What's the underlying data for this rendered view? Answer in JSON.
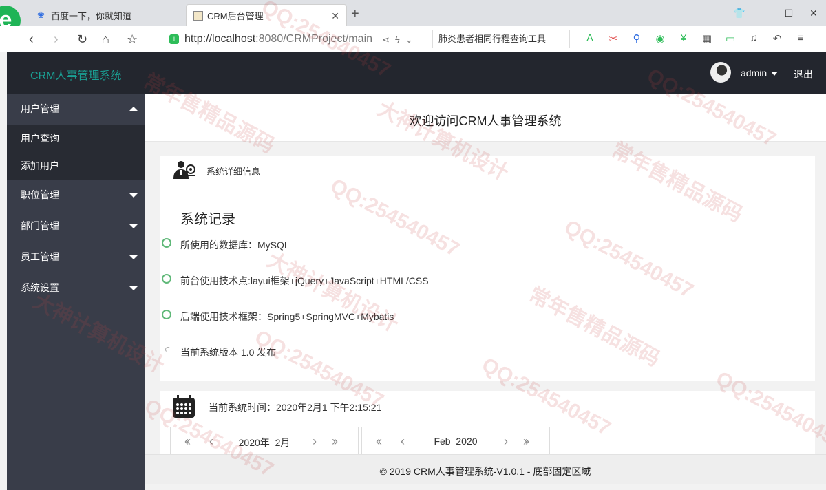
{
  "browser": {
    "tabs": [
      {
        "title": "百度一下，你就知道",
        "active": false
      },
      {
        "title": "CRM后台管理",
        "active": true
      }
    ],
    "url_host": "http://localhost",
    "url_rest": ":8080/CRMProject/main",
    "search_text": "肺炎患者相同行程查询工具"
  },
  "header": {
    "title": "CRM人事管理系统",
    "user": "admin",
    "logout": "退出"
  },
  "sidebar": {
    "items": [
      {
        "label": "用户管理",
        "expanded": true,
        "children": [
          {
            "label": "用户查询"
          },
          {
            "label": "添加用户"
          }
        ]
      },
      {
        "label": "职位管理",
        "expanded": false
      },
      {
        "label": "部门管理",
        "expanded": false
      },
      {
        "label": "员工管理",
        "expanded": false
      },
      {
        "label": "系统设置",
        "expanded": false
      }
    ]
  },
  "main": {
    "welcome": "欢迎访问CRM人事管理系统",
    "info_card": {
      "header": "系统详细信息",
      "records_title": "系统记录",
      "timeline": [
        {
          "text": "所使用的数据库：MySQL"
        },
        {
          "text": "前台使用技术点:layui框架+jQuery+JavaScript+HTML/CSS"
        },
        {
          "text": "后端使用技术框架：Spring5+SpringMVC+Mybatis"
        },
        {
          "text": "当前系统版本 1.0 发布"
        }
      ]
    },
    "time_card": {
      "label": "当前系统时间：2020年2月1 下午2:15:21",
      "calendar_left": {
        "year": "2020年",
        "month": "2月"
      },
      "calendar_right": {
        "month": "Feb",
        "year": "2020"
      }
    }
  },
  "footer": {
    "text": "© 2019 CRM人事管理系统-V1.0.1 - 底部固定区域"
  },
  "watermarks": [
    "QQ:254540457",
    "常年售精品源码",
    "大神计算机设计"
  ],
  "colors": {
    "header_bg": "#23262e",
    "sidebar_bg": "#393d49",
    "subnav_bg": "#282b33",
    "title_accent": "#1aa094",
    "timeline_dot": "#5fb878"
  }
}
